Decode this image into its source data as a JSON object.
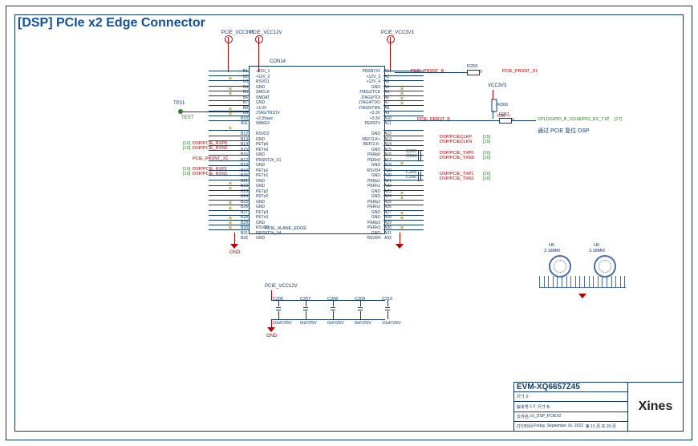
{
  "title": "[DSP] PCIe x2 Edge Connector",
  "connector": {
    "refdes": "CON14",
    "footprint": "PCIE_4LANE_EDGE",
    "left_pins": [
      {
        "num": "B1",
        "name": "+12V_1"
      },
      {
        "num": "B2",
        "name": "+12V_2"
      },
      {
        "num": "B3",
        "name": "RSVD1"
      },
      {
        "num": "B4",
        "name": "GND"
      },
      {
        "num": "B5",
        "name": "SMCLK"
      },
      {
        "num": "B6",
        "name": "SMDAT"
      },
      {
        "num": "B7",
        "name": "GND"
      },
      {
        "num": "B8",
        "name": "+3.3V"
      },
      {
        "num": "B9",
        "name": "JTAG/TRST#"
      },
      {
        "num": "B10",
        "name": "+3.3Vaux"
      },
      {
        "num": "B11",
        "name": "WAKE#"
      },
      {
        "num": "",
        "name": ""
      },
      {
        "num": "B12",
        "name": "RSVD2"
      },
      {
        "num": "B13",
        "name": "GND"
      },
      {
        "num": "B14",
        "name": "PETp0"
      },
      {
        "num": "B15",
        "name": "PETn0"
      },
      {
        "num": "B16",
        "name": "GND"
      },
      {
        "num": "B17",
        "name": "PRSNT2#_X1"
      },
      {
        "num": "B18",
        "name": "GND"
      },
      {
        "num": "B19",
        "name": "PETp1"
      },
      {
        "num": "B20",
        "name": "PETn1"
      },
      {
        "num": "B21",
        "name": "GND"
      },
      {
        "num": "B22",
        "name": "GND"
      },
      {
        "num": "B23",
        "name": "PETp2"
      },
      {
        "num": "B24",
        "name": "PETn2"
      },
      {
        "num": "B25",
        "name": "GND"
      },
      {
        "num": "B26",
        "name": "GND"
      },
      {
        "num": "B27",
        "name": "PETp3"
      },
      {
        "num": "B28",
        "name": "PETn3"
      },
      {
        "num": "B29",
        "name": "GND"
      },
      {
        "num": "B30",
        "name": "RSVD3"
      },
      {
        "num": "B31",
        "name": "PRSNT2#_X4"
      },
      {
        "num": "B32",
        "name": "GND"
      }
    ],
    "right_pins": [
      {
        "num": "A1",
        "name": "PRSNT#1"
      },
      {
        "num": "A2",
        "name": "+12V_3"
      },
      {
        "num": "A3",
        "name": "+12V_4"
      },
      {
        "num": "A4",
        "name": "GND"
      },
      {
        "num": "A5",
        "name": "JTAG2/TCK"
      },
      {
        "num": "A6",
        "name": "JTAG3/TDI"
      },
      {
        "num": "A7",
        "name": "JTAG4/TDO"
      },
      {
        "num": "A8",
        "name": "JTAG5/TMS"
      },
      {
        "num": "A9",
        "name": "+3.3V"
      },
      {
        "num": "A10",
        "name": "+3.3V"
      },
      {
        "num": "A11",
        "name": "PERST#"
      },
      {
        "num": "",
        "name": ""
      },
      {
        "num": "A12",
        "name": "GND"
      },
      {
        "num": "A13",
        "name": "REFCLK+"
      },
      {
        "num": "A14",
        "name": "REFCLK-"
      },
      {
        "num": "A15",
        "name": "GND"
      },
      {
        "num": "A16",
        "name": "PERp0"
      },
      {
        "num": "A17",
        "name": "PERn0"
      },
      {
        "num": "A18",
        "name": "GND"
      },
      {
        "num": "A19",
        "name": "RSVD4"
      },
      {
        "num": "A20",
        "name": "GND"
      },
      {
        "num": "A21",
        "name": "PERp1"
      },
      {
        "num": "A22",
        "name": "PERn1"
      },
      {
        "num": "A23",
        "name": "GND"
      },
      {
        "num": "A24",
        "name": "GND"
      },
      {
        "num": "A25",
        "name": "PERp2"
      },
      {
        "num": "A26",
        "name": "PERn2"
      },
      {
        "num": "A27",
        "name": "GND"
      },
      {
        "num": "A28",
        "name": "GND"
      },
      {
        "num": "A29",
        "name": "PERp3"
      },
      {
        "num": "A30",
        "name": "PERn3"
      },
      {
        "num": "A31",
        "name": "GND"
      },
      {
        "num": "A32",
        "name": "RSVD4"
      }
    ]
  },
  "power": {
    "pcie_vcc3v3_left": "PCIE_VCC3V3",
    "pcie_vcc12v": "PCIE_VCC12V",
    "pcie_vcc3v3_right": "PCIE_VCC3V3",
    "vcc3v3": "VCC3V3",
    "gnd": "GND"
  },
  "testpoint": {
    "ref": "TP21",
    "label": "TEST"
  },
  "nets_left": {
    "rxp0": "DSP/PCIE_RXP0",
    "rxn0": "DSP/PCIE_RXN0",
    "prsnt_x1": "PCIE_PRSNT_X1",
    "rxp1": "DSP/PCIE_RXP1",
    "rxn1": "DSP/PCIE_RXN1",
    "page_rxp0": "[16]",
    "page_rxn0": "[16]",
    "page_rxp1": "[16]",
    "page_rxn1": "[16]"
  },
  "nets_right": {
    "prsnt_b": "PCIE_PRSNT_B",
    "prsnt_x1": "PCIE_PRSNT_X1",
    "perst": "PCIE_PERST_B",
    "clkp": "DSP/PCIECLKP",
    "clkn": "DSP/PCIECLKN",
    "txp0": "DSP/PCIE_TXP0",
    "txn0": "DSP/PCIE_TXN0",
    "txp1": "DSP/PCIE_TXP1",
    "txn1": "DSP/PCIE_TXN1",
    "page_clk": "[15]",
    "page_tx": "[16]",
    "page_perst": "[17]",
    "perst_fpga": "CPLD/GPIO_B_01196/PIO_RX_T1P",
    "r259": "R259",
    "r260": "R260",
    "r261": "R261",
    "r259_val": "0",
    "r261_val": "0",
    "c49": "C49 ···"
  },
  "note_zh": "通过 PCIE 复位 DSP",
  "decoupling": {
    "header": "PCIE_VCC12V",
    "caps": [
      {
        "ref": "C206",
        "val": "10uF/25V"
      },
      {
        "ref": "C207",
        "val": "0nF/25V"
      },
      {
        "ref": "C208",
        "val": "0nF/25V"
      },
      {
        "ref": "C209",
        "val": "0nF/25V"
      },
      {
        "ref": "C210",
        "val": "10uF/25V"
      }
    ],
    "gnd": "GND"
  },
  "mounting": {
    "h5": {
      "ref": "H5",
      "val": "3.18MM"
    },
    "h6": {
      "ref": "H6",
      "val": "3.18MM"
    }
  },
  "titleblock": {
    "project": "EVM-XQ6657Z45",
    "size_lbl": "尺寸",
    "size": "2",
    "rev_lbl": "版本号:",
    "rev": "1.0",
    "rev2_lbl": "尺寸  B",
    "file_lbl": "文件名:",
    "file": "16_DSP_PCIEX2",
    "date_lbl": "打印时间:",
    "date": "Friday, September 16, 2022",
    "sheet": "第 15 页  共 20 页",
    "company": "Xines"
  }
}
